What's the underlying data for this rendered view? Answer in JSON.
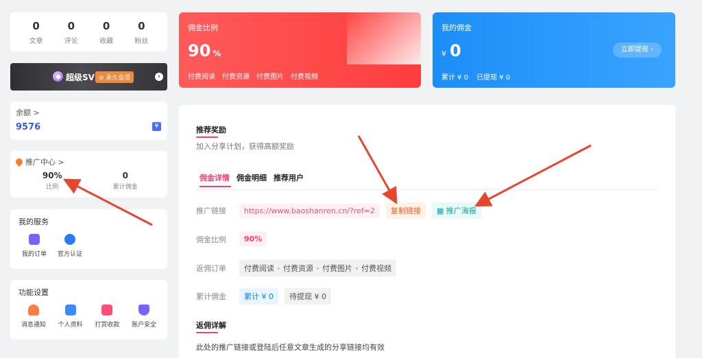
{
  "stats": [
    {
      "num": "0",
      "label": "文章"
    },
    {
      "num": "0",
      "label": "评论"
    },
    {
      "num": "0",
      "label": "收藏"
    },
    {
      "num": "0",
      "label": "粉丝"
    }
  ],
  "svip": {
    "title": "超级SVIP",
    "tag": "⊘ 永久会员"
  },
  "balance": {
    "title": "余额 >",
    "value": "9576"
  },
  "promo": {
    "title": "推广中心 >",
    "rate": "90%",
    "rate_label": "比例",
    "total": "0",
    "total_label": "累计佣金"
  },
  "services": {
    "title": "我的服务",
    "items": [
      {
        "label": "我的订单",
        "icon": "clipboard-icon"
      },
      {
        "label": "官方认证",
        "icon": "verified-badge-icon"
      }
    ]
  },
  "settings": {
    "title": "功能设置",
    "items": [
      {
        "label": "消息通知",
        "icon": "bell-icon"
      },
      {
        "label": "个人资料",
        "icon": "user-card-icon"
      },
      {
        "label": "打赏收款",
        "icon": "gift-icon"
      },
      {
        "label": "账户安全",
        "icon": "shield-icon"
      }
    ]
  },
  "rate_card": {
    "title": "佣金比例",
    "value": "90",
    "unit": "%",
    "links": [
      "付费阅读",
      "付费资源",
      "付费图片",
      "付费视频"
    ]
  },
  "comm_card": {
    "title": "我的佣金",
    "currency": "¥",
    "value": "0",
    "accum": "累计 ¥ 0",
    "withdrawn": "已提现 ¥ 0",
    "button": "立即提现 ›"
  },
  "main": {
    "title": "推荐奖励",
    "subtitle": "加入分享计划，获得高额奖励",
    "tabs": [
      "佣金详情",
      "佣金明细",
      "推荐用户"
    ],
    "link_label": "推广链接",
    "link_url": "https://www.baoshanren.cn/?ref=2",
    "copy_button": "复制链接",
    "poster_button": "推广海报",
    "rate_label": "佣金比例",
    "rate_value": "90%",
    "orders_label": "返佣订单",
    "orders": [
      "付费阅读",
      "付费资源",
      "付费图片",
      "付费视频"
    ],
    "accum_label": "累计佣金",
    "accum_value": "累计 ¥ 0",
    "pending_value": "待提现 ¥ 0",
    "detail_title": "返佣详解",
    "detail_note": "此处的推广链接或登陆后任意文章生成的分享链接均有效"
  },
  "colors": {
    "accent": "#ff3d6e",
    "red_card": "#ff4d4d",
    "blue_card": "#2b97fc",
    "arrow": "#e8452e"
  }
}
